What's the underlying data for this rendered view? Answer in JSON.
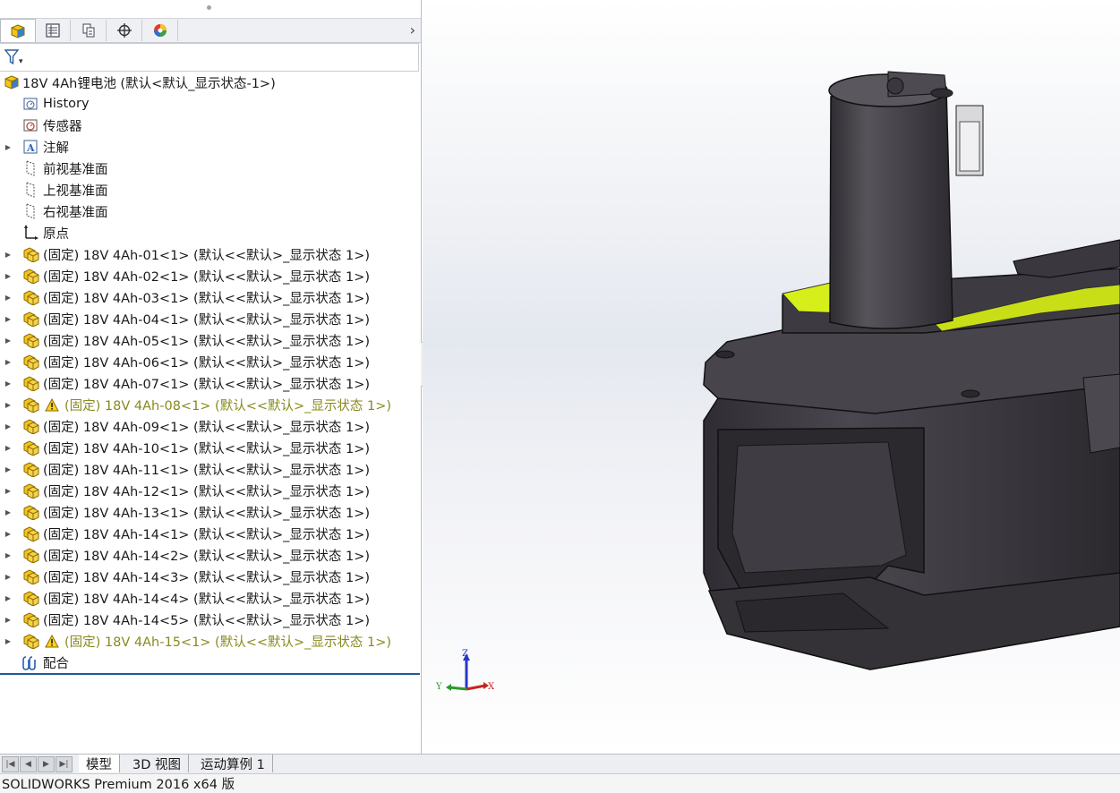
{
  "panel": {
    "tabs": [
      {
        "name": "featuremanager-tab",
        "icon": "part-cube-icon"
      },
      {
        "name": "propertymanager-tab",
        "icon": "property-list-icon"
      },
      {
        "name": "configurationmanager-tab",
        "icon": "configuration-icon"
      },
      {
        "name": "dimxpert-tab",
        "icon": "crosshair-icon"
      },
      {
        "name": "display-manager-tab",
        "icon": "color-wheel-icon"
      }
    ],
    "overflow_icon": "chevron-right-icon",
    "filter_icon": "filter-icon",
    "filter_dropdown": "▾"
  },
  "tree": {
    "root": "18V 4Ah锂电池  (默认<默认_显示状态-1>)",
    "items": [
      {
        "label": "History",
        "icon": "history-icon",
        "expand": false
      },
      {
        "label": "传感器",
        "icon": "sensor-icon",
        "expand": false
      },
      {
        "label": "注解",
        "icon": "annotation-icon",
        "expand": true
      },
      {
        "label": "前视基准面",
        "icon": "plane-icon",
        "expand": false
      },
      {
        "label": "上视基准面",
        "icon": "plane-icon",
        "expand": false
      },
      {
        "label": "右视基准面",
        "icon": "plane-icon",
        "expand": false
      },
      {
        "label": "原点",
        "icon": "origin-icon",
        "expand": false
      },
      {
        "label": "(固定) 18V 4Ah-01<1> (默认<<默认>_显示状态 1>)",
        "icon": "component-icon",
        "expand": true
      },
      {
        "label": "(固定) 18V 4Ah-02<1> (默认<<默认>_显示状态 1>)",
        "icon": "component-icon",
        "expand": true
      },
      {
        "label": "(固定) 18V 4Ah-03<1> (默认<<默认>_显示状态 1>)",
        "icon": "component-icon",
        "expand": true
      },
      {
        "label": "(固定) 18V 4Ah-04<1> (默认<<默认>_显示状态 1>)",
        "icon": "component-icon",
        "expand": true
      },
      {
        "label": "(固定) 18V 4Ah-05<1> (默认<<默认>_显示状态 1>)",
        "icon": "component-icon",
        "expand": true
      },
      {
        "label": "(固定) 18V 4Ah-06<1> (默认<<默认>_显示状态 1>)",
        "icon": "component-icon",
        "expand": true
      },
      {
        "label": "(固定) 18V 4Ah-07<1> (默认<<默认>_显示状态 1>)",
        "icon": "component-icon",
        "expand": true
      },
      {
        "label": "(固定) 18V 4Ah-08<1> (默认<<默认>_显示状态 1>)",
        "icon": "component-icon",
        "expand": true,
        "warning": true
      },
      {
        "label": "(固定) 18V 4Ah-09<1> (默认<<默认>_显示状态 1>)",
        "icon": "component-icon",
        "expand": true
      },
      {
        "label": "(固定) 18V 4Ah-10<1> (默认<<默认>_显示状态 1>)",
        "icon": "component-icon",
        "expand": true
      },
      {
        "label": "(固定) 18V 4Ah-11<1> (默认<<默认>_显示状态 1>)",
        "icon": "component-icon",
        "expand": true
      },
      {
        "label": "(固定) 18V 4Ah-12<1> (默认<<默认>_显示状态 1>)",
        "icon": "component-icon",
        "expand": true
      },
      {
        "label": "(固定) 18V 4Ah-13<1> (默认<<默认>_显示状态 1>)",
        "icon": "component-icon",
        "expand": true
      },
      {
        "label": "(固定) 18V 4Ah-14<1> (默认<<默认>_显示状态 1>)",
        "icon": "component-icon",
        "expand": true
      },
      {
        "label": "(固定) 18V 4Ah-14<2> (默认<<默认>_显示状态 1>)",
        "icon": "component-icon",
        "expand": true
      },
      {
        "label": "(固定) 18V 4Ah-14<3> (默认<<默认>_显示状态 1>)",
        "icon": "component-icon",
        "expand": true
      },
      {
        "label": "(固定) 18V 4Ah-14<4> (默认<<默认>_显示状态 1>)",
        "icon": "component-icon",
        "expand": true
      },
      {
        "label": "(固定) 18V 4Ah-14<5> (默认<<默认>_显示状态 1>)",
        "icon": "component-icon",
        "expand": true
      },
      {
        "label": "(固定) 18V 4Ah-15<1> (默认<<默认>_显示状态 1>)",
        "icon": "component-icon",
        "expand": true,
        "warning": true
      },
      {
        "label": "配合",
        "icon": "mate-icon",
        "expand": false
      }
    ]
  },
  "triad": {
    "x": "X",
    "y": "Y",
    "z": "Z"
  },
  "bottom_tabs": [
    "模型",
    "3D 视图",
    "运动算例 1"
  ],
  "status_bar": "SOLIDWORKS Premium 2016 x64 版",
  "colors": {
    "accent_blue": "#1e5a9c",
    "warning_text": "#888a1e",
    "battery_body": "#3d3b40",
    "battery_highlight": "#d6ee1a"
  }
}
